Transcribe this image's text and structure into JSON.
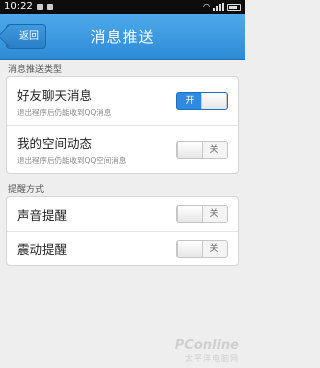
{
  "status_bar": {
    "time": "10:22"
  },
  "header": {
    "back_label": "返回",
    "title": "消息推送"
  },
  "sections": [
    {
      "label": "消息推送类型",
      "rows": [
        {
          "title": "好友聊天消息",
          "subtitle": "退出程序后仍能收到QQ消息",
          "state": "开"
        },
        {
          "title": "我的空间动态",
          "subtitle": "退出程序后仍能收到QQ空间消息",
          "state": "关"
        }
      ]
    },
    {
      "label": "提醒方式",
      "rows": [
        {
          "title": "声音提醒",
          "state": "关"
        },
        {
          "title": "震动提醒",
          "state": "关"
        }
      ]
    }
  ],
  "watermark": {
    "main": "PConline",
    "sub": "太平洋电脑网"
  },
  "colors": {
    "header": "#2d8bd6",
    "toggle_on": "#2e8be0"
  }
}
